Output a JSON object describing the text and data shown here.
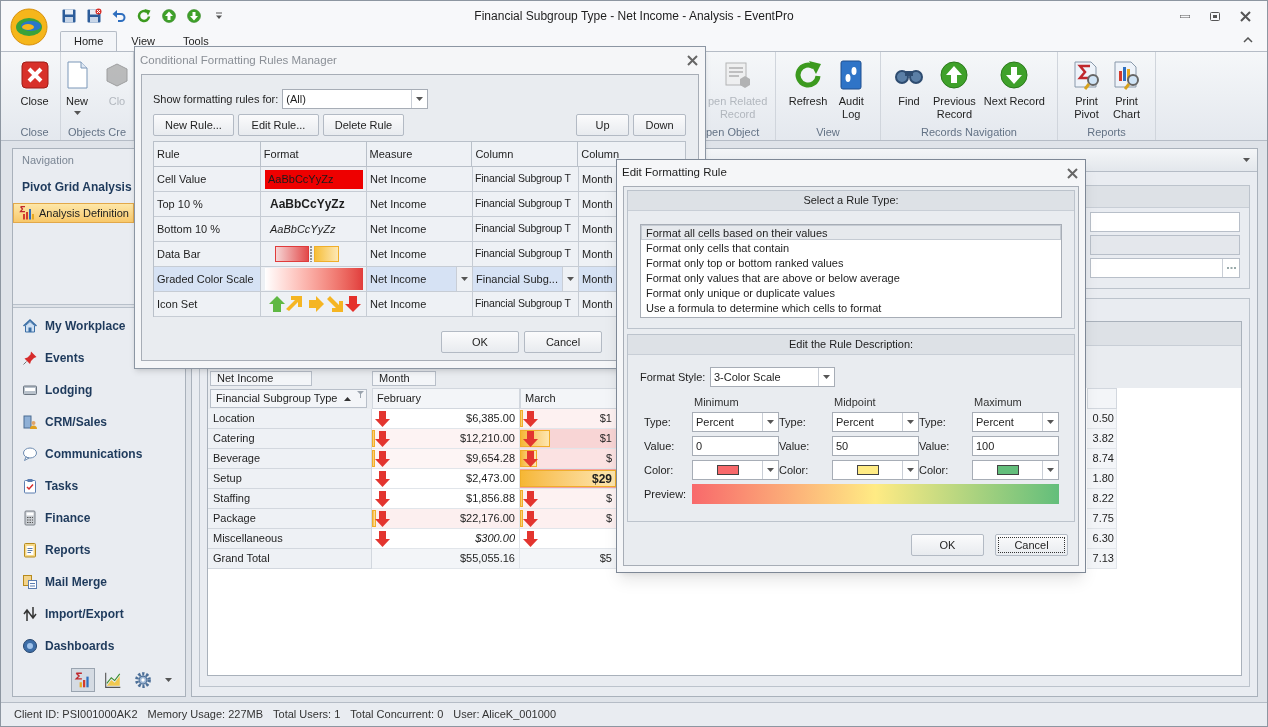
{
  "window": {
    "title": "Financial Subgroup Type - Net Income - Analysis - EventPro"
  },
  "quick_access": [
    {
      "kind": "save"
    },
    {
      "kind": "save_close"
    },
    {
      "kind": "undo"
    },
    {
      "kind": "refresh"
    },
    {
      "kind": "up"
    },
    {
      "kind": "down"
    },
    {
      "kind": "customize"
    }
  ],
  "ribbon": {
    "tabs": [
      {
        "label": "Home",
        "selected": true
      },
      {
        "label": "View",
        "selected": false
      },
      {
        "label": "Tools",
        "selected": false
      }
    ],
    "groups": [
      {
        "label": "Close",
        "buttons": [
          {
            "kind": "close",
            "label": "Close",
            "disabled": false,
            "dropdown": false
          }
        ]
      },
      {
        "label": "Objects Cre",
        "buttons": [
          {
            "kind": "new",
            "label": "New",
            "disabled": false,
            "dropdown": true
          },
          {
            "kind": "clone",
            "label": "Clo",
            "disabled": true,
            "dropdown": false
          }
        ]
      },
      {
        "label": "pen Object",
        "buttons": [
          {
            "kind": "related",
            "label": "pen Related\nRecord",
            "disabled": true,
            "dropdown": false
          }
        ]
      },
      {
        "label": "View",
        "buttons": [
          {
            "kind": "refresh",
            "label": "Refresh",
            "disabled": false,
            "dropdown": false
          },
          {
            "kind": "audit",
            "label": "Audit\nLog",
            "disabled": false,
            "dropdown": false
          }
        ]
      },
      {
        "label": "Records Navigation",
        "buttons": [
          {
            "kind": "find",
            "label": "Find",
            "disabled": false,
            "dropdown": false
          },
          {
            "kind": "previous",
            "label": "Previous\nRecord",
            "disabled": false,
            "dropdown": false
          },
          {
            "kind": "next",
            "label": "Next Record",
            "disabled": false,
            "dropdown": false
          }
        ]
      },
      {
        "label": "Reports",
        "buttons": [
          {
            "kind": "print_pivot",
            "label": "Print\nPivot",
            "disabled": false,
            "dropdown": false
          },
          {
            "kind": "print_chart",
            "label": "Print\nChart",
            "disabled": false,
            "dropdown": false
          }
        ]
      }
    ]
  },
  "navigation": {
    "title": "Navigation",
    "section": "Pivot Grid Analysis",
    "items": [
      {
        "label": "Analysis Definition",
        "selected": true
      }
    ],
    "modules": [
      {
        "kind": "home",
        "label": "My Workplace"
      },
      {
        "kind": "pin",
        "label": "Events"
      },
      {
        "kind": "lodging",
        "label": "Lodging"
      },
      {
        "kind": "crm",
        "label": "CRM/Sales"
      },
      {
        "kind": "bubble",
        "label": "Communications"
      },
      {
        "kind": "tasks",
        "label": "Tasks"
      },
      {
        "kind": "finance",
        "label": "Finance"
      },
      {
        "kind": "reports",
        "label": "Reports"
      },
      {
        "kind": "mail",
        "label": "Mail Merge"
      },
      {
        "kind": "transfer",
        "label": "Import/Export"
      },
      {
        "kind": "globe",
        "label": "Dashboards"
      }
    ],
    "switcher": [
      {
        "kind": "pivot",
        "selected": true
      },
      {
        "kind": "chart",
        "selected": false
      },
      {
        "kind": "settings",
        "selected": false
      }
    ]
  },
  "pivot": {
    "data_field": "Net Income",
    "column_field": "Month",
    "row_header": "Financial Subgroup Type",
    "columns": [
      "February",
      "March"
    ],
    "rows": [
      {
        "label": "Location",
        "cells": [
          {
            "text": "$6,385.00",
            "arrow": true,
            "color": "#ffffff",
            "bold": false,
            "italic": false
          },
          {
            "text": "$1",
            "arrow": true,
            "level": 0.03,
            "color": "#fdf1f1",
            "bold": false,
            "italic": false
          }
        ],
        "tail": "0.50"
      },
      {
        "label": "Catering",
        "cells": [
          {
            "text": "$12,210.00",
            "arrow": true,
            "level": 0.02,
            "color": "#fdf3f3",
            "bold": false,
            "italic": false
          },
          {
            "text": "$1",
            "arrow": true,
            "level": 0.31,
            "color": "#f8d5d5",
            "bold": false,
            "italic": false
          }
        ],
        "tail": "3.82"
      },
      {
        "label": "Beverage",
        "cells": [
          {
            "text": "$9,654.28",
            "arrow": true,
            "level": 0.02,
            "color": "#fdf5f5",
            "bold": false,
            "italic": false
          },
          {
            "text": "$",
            "arrow": true,
            "level": 0.18,
            "color": "#fbe2e2",
            "bold": false,
            "italic": false
          }
        ],
        "tail": "8.74"
      },
      {
        "label": "Setup",
        "cells": [
          {
            "text": "$2,473.00",
            "arrow": true,
            "color": "#ffffff",
            "bold": false,
            "italic": false
          },
          {
            "text": "$29",
            "arrow": false,
            "level": 1,
            "color": "#f2a19e",
            "bold": true,
            "italic": false
          }
        ],
        "tail": "1.80"
      },
      {
        "label": "Staffing",
        "cells": [
          {
            "text": "$1,856.88",
            "arrow": true,
            "color": "#ffffff",
            "bold": false,
            "italic": false
          },
          {
            "text": "$",
            "arrow": true,
            "level": 0.03,
            "color": "#fdf2f2",
            "bold": false,
            "italic": false
          }
        ],
        "tail": "8.22"
      },
      {
        "label": "Package",
        "cells": [
          {
            "text": "$22,176.00",
            "arrow": true,
            "level": 0.03,
            "color": "#fcefef",
            "bold": false,
            "italic": false
          },
          {
            "text": "$",
            "arrow": true,
            "level": 0.03,
            "color": "#fdf0f0",
            "bold": false,
            "italic": false
          }
        ],
        "tail": "7.75"
      },
      {
        "label": "Miscellaneous",
        "cells": [
          {
            "text": "$300.00",
            "arrow": true,
            "color": "#ffffff",
            "bold": false,
            "italic": true
          },
          {
            "arrow": true,
            "color": "#ffffff"
          }
        ],
        "tail": "6.30"
      },
      {
        "label": "Grand Total",
        "cells": [
          {
            "text": "$55,055.16",
            "arrow": false,
            "color": "#f3f5f8",
            "bold": false,
            "italic": false
          },
          {
            "text": "$5",
            "arrow": false,
            "color": "#f3f5f8",
            "bold": false,
            "italic": false
          }
        ],
        "tail": "7.13"
      }
    ]
  },
  "rules_manager": {
    "title": "Conditional Formatting Rules Manager",
    "active": false,
    "show_label": "Show formatting rules for:",
    "show_value": "(All)",
    "buttons": [
      "New Rule...",
      "Edit Rule...",
      "Delete Rule"
    ],
    "order_buttons": [
      "Up",
      "Down"
    ],
    "columns": [
      "Rule",
      "Format",
      "Measure",
      "Column",
      "Column"
    ],
    "rows": [
      {
        "rule": "Cell Value",
        "format": {
          "kind": "fill",
          "sample": "AaBbCcYyZz"
        },
        "measure": "Net Income",
        "column": "Financial Subgroup T",
        "column_2": "Month",
        "selected": false
      },
      {
        "rule": "Top 10 %",
        "format": {
          "kind": "bold",
          "sample": "AaBbCcYyZz"
        },
        "measure": "Net Income",
        "column": "Financial Subgroup T",
        "column_2": "Month",
        "selected": false
      },
      {
        "rule": "Bottom 10 %",
        "format": {
          "kind": "italic",
          "sample": "AaBbCcYyZz"
        },
        "measure": "Net Income",
        "column": "Financial Subgroup T",
        "column_2": "Month",
        "selected": false
      },
      {
        "rule": "Data Bar",
        "format": {
          "kind": "data_bar"
        },
        "measure": "Net Income",
        "column": "Financial Subgroup T",
        "column_2": "Month",
        "selected": false
      },
      {
        "rule": "Graded Color Scale",
        "format": {
          "kind": "color_scale"
        },
        "measure": "Net Income",
        "column": "Financial Subg...",
        "column_2": "Month",
        "selected": true
      },
      {
        "rule": "Icon Set",
        "format": {
          "kind": "icon_set"
        },
        "measure": "Net Income",
        "column": "Financial Subgroup T",
        "column_2": "Month",
        "selected": false
      }
    ],
    "footer_buttons": [
      "OK",
      "Cancel"
    ]
  },
  "edit_rule": {
    "title": "Edit Formatting Rule",
    "active": true,
    "type_header": "Select a Rule Type:",
    "rule_types": [
      {
        "label": "Format all cells based on their values",
        "selected": true
      },
      {
        "label": "Format only cells that contain",
        "selected": false
      },
      {
        "label": "Format only top or bottom ranked values",
        "selected": false
      },
      {
        "label": "Format only values that are above or below average",
        "selected": false
      },
      {
        "label": "Format only unique or duplicate values",
        "selected": false
      },
      {
        "label": "Use a formula to determine which cells to format",
        "selected": false
      }
    ],
    "description_header": "Edit the Rule Description:",
    "format_style_label": "Format Style:",
    "format_style": "3-Color Scale",
    "points": [
      {
        "heading": "Minimum",
        "type_label": "Type:",
        "type": "Percent",
        "value_label": "Value:",
        "value": "0",
        "color_label": "Color:",
        "color": "#f8696b"
      },
      {
        "heading": "Midpoint",
        "type_label": "Type:",
        "type": "Percent",
        "value_label": "Value:",
        "value": "50",
        "color_label": "Color:",
        "color": "#ffeb84"
      },
      {
        "heading": "Maximum",
        "type_label": "Type:",
        "type": "Percent",
        "value_label": "Value:",
        "value": "100",
        "color_label": "Color:",
        "color": "#63be7b"
      }
    ],
    "preview_label": "Preview:",
    "buttons": [
      {
        "label": "OK",
        "focused": false
      },
      {
        "label": "Cancel",
        "focused": true
      }
    ]
  },
  "status_bar": [
    "Client ID: PSI001000AK2",
    "Memory Usage: 227MB",
    "Total Users: 1",
    "Total Concurrent: 0",
    "User: AliceK_001000"
  ]
}
